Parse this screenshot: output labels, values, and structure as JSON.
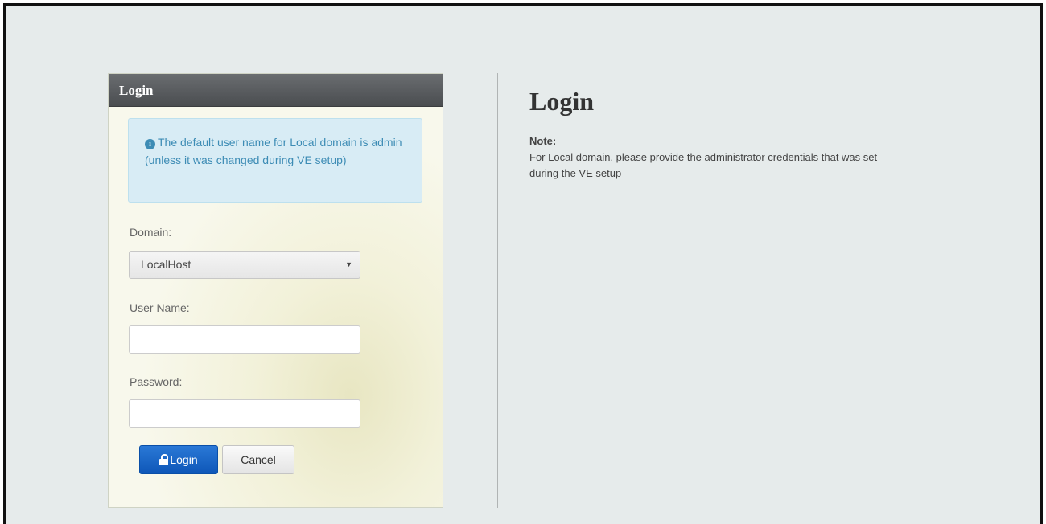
{
  "login_panel": {
    "header_title": "Login",
    "info_message": "The default user name for Local domain is admin (unless it was changed during VE setup)",
    "domain_label": "Domain:",
    "domain_selected": "LocalHost",
    "username_label": "User Name:",
    "username_value": "",
    "password_label": "Password:",
    "password_value": "",
    "login_button": "Login",
    "cancel_button": "Cancel"
  },
  "help_panel": {
    "title": "Login",
    "note_label": "Note:",
    "note_text": "For Local domain, please provide the administrator credentials that was set during the VE setup"
  },
  "icons": {
    "info": "info-circle-icon",
    "lock": "lock-icon",
    "dropdown": "caret-down-icon"
  },
  "colors": {
    "header_bg": "#55585b",
    "info_bg": "#d8ecf5",
    "info_text": "#3d8cb5",
    "primary_button": "#0e57b8",
    "page_bg": "#e6ebeb"
  }
}
